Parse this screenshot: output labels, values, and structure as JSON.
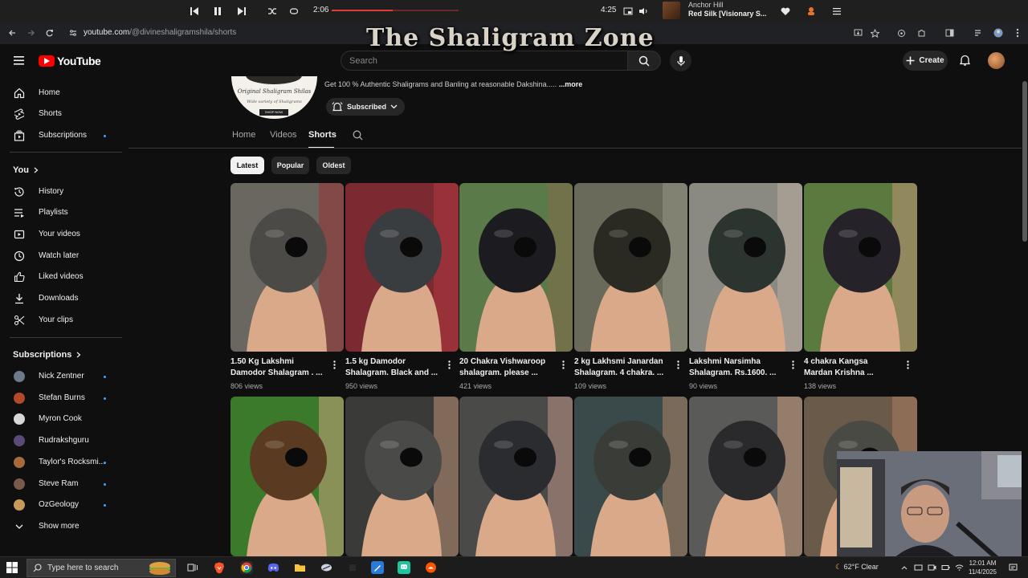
{
  "overlay_title": "The Shaligram Zone",
  "media_bar": {
    "elapsed": "2:06",
    "total": "4:25",
    "progress": 0.48,
    "artist": "Anchor Hill",
    "song": "Red Silk [Visionary S..."
  },
  "browser": {
    "url_domain": "youtube.com",
    "url_path": "/@divineshaligramshila/shorts"
  },
  "header": {
    "logo_text": "YouTube",
    "search_placeholder": "Search",
    "create_label": "Create"
  },
  "sidebar": {
    "main_items": [
      {
        "label": "Home",
        "icon": "home-icon"
      },
      {
        "label": "Shorts",
        "icon": "shorts-icon"
      },
      {
        "label": "Subscriptions",
        "icon": "subscriptions-icon",
        "dot": true
      }
    ],
    "you_heading": "You",
    "you_items": [
      {
        "label": "History",
        "icon": "history-icon"
      },
      {
        "label": "Playlists",
        "icon": "playlists-icon"
      },
      {
        "label": "Your videos",
        "icon": "your-videos-icon"
      },
      {
        "label": "Watch later",
        "icon": "watch-later-icon"
      },
      {
        "label": "Liked videos",
        "icon": "liked-icon"
      },
      {
        "label": "Downloads",
        "icon": "download-icon"
      },
      {
        "label": "Your clips",
        "icon": "scissors-icon"
      }
    ],
    "subscriptions_heading": "Subscriptions",
    "subscriptions": [
      {
        "name": "Nick Zentner",
        "dot": true,
        "color": "#6b7b8c"
      },
      {
        "name": "Stefan Burns",
        "dot": true,
        "color": "#b54a2a"
      },
      {
        "name": "Myron Cook",
        "dot": false,
        "color": "#d8d8d8"
      },
      {
        "name": "Rudrakshguru",
        "dot": false,
        "color": "#5a4a7a"
      },
      {
        "name": "Taylor's Rocksmi...",
        "dot": true,
        "color": "#a86a3a"
      },
      {
        "name": "Steve Ram",
        "dot": true,
        "color": "#7a5a4a"
      },
      {
        "name": "OzGeology",
        "dot": true,
        "color": "#c89a5a"
      }
    ],
    "show_more": "Show more"
  },
  "channel": {
    "avatar_text": "Original Shaligram Shilas",
    "avatar_sub": "Wide variety of Shaligrams",
    "avatar_shop": "SHOP NOW",
    "description": "Get 100 % Authentic Shaligrams and Banling at reasonable Dakshina.....",
    "more": "...more",
    "subscribe_label": "Subscribed"
  },
  "tabs": [
    "Home",
    "Videos",
    "Shorts"
  ],
  "active_tab": "Shorts",
  "chips": [
    "Latest",
    "Popular",
    "Oldest"
  ],
  "active_chip": "Latest",
  "shorts": [
    {
      "title1": "1.50 Kg Lakshmi",
      "title2": "Damodor Shalagram . ...",
      "views": "806 views",
      "bg": "#6a6660",
      "stone": "#4c4a46",
      "accent": "#9b2c2c"
    },
    {
      "title1": "1.5 kg Damodor",
      "title2": "Shalagram. Black and ...",
      "views": "950 views",
      "bg": "#7a2a30",
      "stone": "#3a3d40",
      "accent": "#b83a40"
    },
    {
      "title1": "20 Chakra Vishwaroop",
      "title2": "shalagram. please ...",
      "views": "421 views",
      "bg": "#5a7a4a",
      "stone": "#1c1c20",
      "accent": "#8a6a4a"
    },
    {
      "title1": "2 kg Lakhsmi Janardan",
      "title2": "Shalagram. 4 chakra. ...",
      "views": "109 views",
      "bg": "#6a6a5a",
      "stone": "#2a2a22",
      "accent": "#9a9a8a"
    },
    {
      "title1": "Lakshmi Narsimha",
      "title2": "Shalagram. Rs.1600. ...",
      "views": "90 views",
      "bg": "#8a8a82",
      "stone": "#2c3430",
      "accent": "#c0b0a0"
    },
    {
      "title1": "4 chakra Kangsa",
      "title2": "Mardan Krishna ...",
      "views": "138 views",
      "bg": "#5a7a40",
      "stone": "#26222a",
      "accent": "#c8987a"
    },
    {
      "title1": "",
      "title2": "",
      "views": "",
      "bg": "#3a7a2a",
      "stone": "#5a3a20",
      "accent": "#d8a888"
    },
    {
      "title1": "",
      "title2": "",
      "views": "",
      "bg": "#3a3a38",
      "stone": "#4a4a48",
      "accent": "#c89a7a"
    },
    {
      "title1": "",
      "title2": "",
      "views": "",
      "bg": "#4a4a48",
      "stone": "#2a2c30",
      "accent": "#c89a8a"
    },
    {
      "title1": "",
      "title2": "",
      "views": "",
      "bg": "#3a4a4a",
      "stone": "#3a3c38",
      "accent": "#b88a6a"
    },
    {
      "title1": "",
      "title2": "",
      "views": "",
      "bg": "#5a5a58",
      "stone": "#2a2a2c",
      "accent": "#d0a080"
    },
    {
      "title1": "",
      "title2": "",
      "views": "",
      "bg": "#6a5a4a",
      "stone": "#4a4a44",
      "accent": "#b08060"
    }
  ],
  "taskbar": {
    "search_placeholder": "Type here to search",
    "weather": "62°F  Clear",
    "time": "12:01 AM",
    "date": "11/4/2025"
  }
}
